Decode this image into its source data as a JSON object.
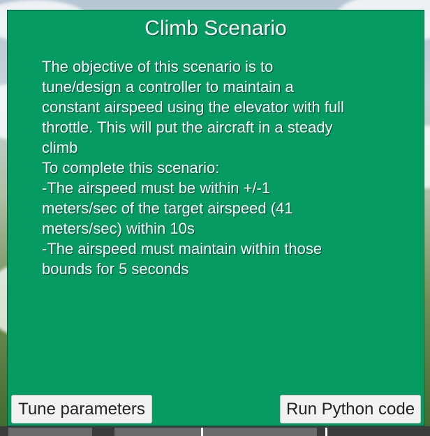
{
  "dialog": {
    "title": "Climb Scenario",
    "description": "The objective of this scenario is to\ntune/design a controller to maintain a\nconstant airspeed using the elevator with full\nthrottle. This will put the aircraft in a steady\nclimb\nTo complete this scenario:\n-The airspeed must be within +/-1\nmeters/sec of the target airspeed (41\nmeters/sec) within 10s\n-The airspeed must maintain within those\nbounds for 5 seconds",
    "tune_button_label": "Tune parameters",
    "run_button_label": "Run Python code"
  },
  "colors": {
    "dialog_background": "#069b63",
    "button_background": "#f2f2f2",
    "text": "#ffffff"
  }
}
